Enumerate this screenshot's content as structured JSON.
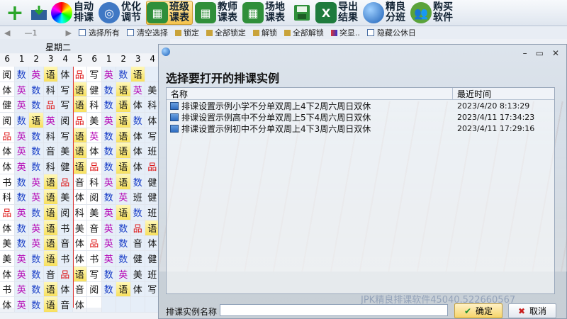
{
  "toolbar": {
    "buttons": [
      {
        "label": "自动排课"
      },
      {
        "label": "优化调节"
      },
      {
        "label": "班级课表"
      },
      {
        "label": "教师课表"
      },
      {
        "label": "场地课表"
      },
      {
        "label": "导出结果"
      },
      {
        "label": "精良分班"
      },
      {
        "label": "购买软件"
      }
    ]
  },
  "bar2": {
    "page": "—1",
    "select_all": "选择所有",
    "clear_select": "清空选择",
    "lock": "锁定",
    "lock_all": "全部锁定",
    "unlock": "解锁",
    "unlock_all": "全部解锁",
    "highlight": "突显..",
    "hide_holiday": "隐藏公休日"
  },
  "schedule": {
    "day_label": "星期二",
    "periods": [
      "6",
      "1",
      "2",
      "3",
      "4",
      "5",
      "6",
      "1",
      "2",
      "3",
      "4"
    ],
    "rows": [
      [
        "阅",
        "数",
        "英",
        "语",
        "体",
        "品",
        "写",
        "英",
        "数",
        "语",
        ""
      ],
      [
        "体",
        "英",
        "数",
        "科",
        "写",
        "语",
        "健",
        "数",
        "语",
        "英",
        "美"
      ],
      [
        "健",
        "英",
        "数",
        "品",
        "写",
        "语",
        "科",
        "数",
        "语",
        "体",
        "科"
      ],
      [
        "阅",
        "数",
        "语",
        "英",
        "阅",
        "品",
        "美",
        "英",
        "语",
        "数",
        "体"
      ],
      [
        "品",
        "英",
        "数",
        "科",
        "写",
        "语",
        "英",
        "数",
        "语",
        "体",
        "写"
      ],
      [
        "体",
        "英",
        "数",
        "音",
        "美",
        "语",
        "体",
        "数",
        "语",
        "体",
        "班"
      ],
      [
        "体",
        "英",
        "数",
        "科",
        "健",
        "语",
        "品",
        "数",
        "语",
        "体",
        "品"
      ],
      [
        "书",
        "数",
        "英",
        "语",
        "品",
        "音",
        "科",
        "英",
        "语",
        "数",
        "健"
      ],
      [
        "科",
        "数",
        "英",
        "语",
        "美",
        "体",
        "阅",
        "数",
        "英",
        "班",
        "健"
      ],
      [
        "品",
        "英",
        "数",
        "语",
        "阅",
        "科",
        "美",
        "英",
        "语",
        "数",
        "班"
      ],
      [
        "体",
        "数",
        "英",
        "语",
        "书",
        "美",
        "音",
        "英",
        "数",
        "品",
        "语"
      ],
      [
        "美",
        "数",
        "英",
        "语",
        "音",
        "体",
        "品",
        "英",
        "数",
        "音",
        "体"
      ],
      [
        "美",
        "英",
        "数",
        "语",
        "书",
        "体",
        "书",
        "英",
        "数",
        "健",
        "健"
      ],
      [
        "体",
        "英",
        "数",
        "音",
        "品",
        "语",
        "写",
        "数",
        "英",
        "美",
        "班"
      ],
      [
        "书",
        "英",
        "数",
        "语",
        "体",
        "音",
        "阅",
        "数",
        "语",
        "体",
        "写"
      ],
      [
        "体",
        "英",
        "数",
        "语",
        "音",
        "体",
        "",
        "",
        "",
        "",
        ""
      ]
    ]
  },
  "dialog": {
    "title": "选择要打开的排课实例",
    "col_name": "名称",
    "col_time": "最近时间",
    "items": [
      {
        "name": "排课设置示例小学不分单双周上4下2周六周日双休",
        "time": "2023/4/20 8:13:29"
      },
      {
        "name": "排课设置示例高中不分单双周上5下4周六周日双休",
        "time": "2023/4/11 17:34:23"
      },
      {
        "name": "排课设置示例初中不分单双周上4下3周六周日双休",
        "time": "2023/4/11 17:29:16"
      }
    ],
    "watermark": "JPK精良排课软件45040.522660567",
    "name_label": "排课实例名称",
    "name_value": "",
    "ok": "确定",
    "cancel": "取消"
  }
}
